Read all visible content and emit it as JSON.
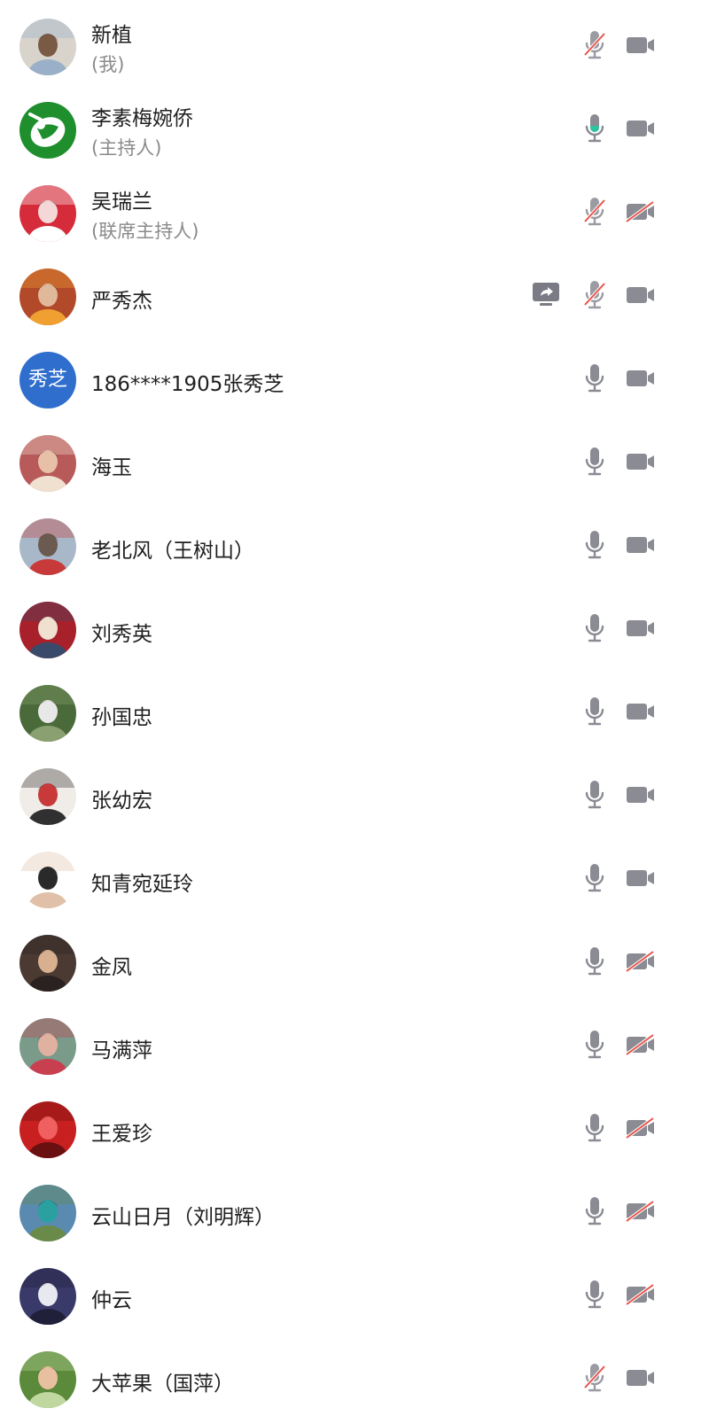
{
  "participants": [
    {
      "name": "新植",
      "role": "(我)",
      "mic": "muted",
      "cam": "on",
      "sharing": false,
      "avatar": {
        "type": "photo",
        "bg": "#d8d4cc",
        "fg": "#7a5a44",
        "accent": "#9ab0c8"
      }
    },
    {
      "name": "李素梅婉侨",
      "role": "(主持人)",
      "mic": "speaking",
      "cam": "on",
      "sharing": false,
      "avatar": {
        "type": "logo",
        "bg": "#1f8f2e",
        "fg": "#ffffff",
        "accent": "#1f8f2e"
      }
    },
    {
      "name": "吴瑞兰",
      "role": "(联席主持人)",
      "mic": "muted",
      "cam": "off",
      "sharing": false,
      "avatar": {
        "type": "photo",
        "bg": "#d52b3a",
        "fg": "#f4d8d8",
        "accent": "#ffffff"
      }
    },
    {
      "name": "严秀杰",
      "role": "",
      "mic": "muted",
      "cam": "on",
      "sharing": true,
      "avatar": {
        "type": "photo",
        "bg": "#b24a2a",
        "fg": "#e0b89a",
        "accent": "#f0a030"
      }
    },
    {
      "name": "186****1905张秀芝",
      "role": "",
      "mic": "on",
      "cam": "on",
      "sharing": false,
      "avatar": {
        "type": "text",
        "text": "秀芝",
        "bg": "#2f6ecd"
      }
    },
    {
      "name": "海玉",
      "role": "",
      "mic": "on",
      "cam": "on",
      "sharing": false,
      "avatar": {
        "type": "photo",
        "bg": "#b85a5a",
        "fg": "#e8c0a8",
        "accent": "#f0e0d0"
      }
    },
    {
      "name": "老北风（王树山）",
      "role": "",
      "mic": "on",
      "cam": "on",
      "sharing": false,
      "avatar": {
        "type": "photo",
        "bg": "#a8b8c8",
        "fg": "#6a5a50",
        "accent": "#c83a3a"
      }
    },
    {
      "name": "刘秀英",
      "role": "",
      "mic": "on",
      "cam": "on",
      "sharing": false,
      "avatar": {
        "type": "photo",
        "bg": "#a8202a",
        "fg": "#f0e0d0",
        "accent": "#3a4a6a"
      }
    },
    {
      "name": "孙国忠",
      "role": "",
      "mic": "on",
      "cam": "on",
      "sharing": false,
      "avatar": {
        "type": "photo",
        "bg": "#4a6a3a",
        "fg": "#e8e8e8",
        "accent": "#8aa070"
      }
    },
    {
      "name": "张幼宏",
      "role": "",
      "mic": "on",
      "cam": "on",
      "sharing": false,
      "avatar": {
        "type": "photo",
        "bg": "#f0ece8",
        "fg": "#c83a3a",
        "accent": "#303030"
      }
    },
    {
      "name": "知青宛延玲",
      "role": "",
      "mic": "on",
      "cam": "on",
      "sharing": false,
      "avatar": {
        "type": "photo",
        "bg": "#ffffff",
        "fg": "#2a2a2a",
        "accent": "#e0c0a8"
      }
    },
    {
      "name": "金凤",
      "role": "",
      "mic": "on",
      "cam": "off",
      "sharing": false,
      "avatar": {
        "type": "photo",
        "bg": "#4a3a32",
        "fg": "#d8b090",
        "accent": "#2a2220"
      }
    },
    {
      "name": "马满萍",
      "role": "",
      "mic": "on",
      "cam": "off",
      "sharing": false,
      "avatar": {
        "type": "photo",
        "bg": "#7a9a8a",
        "fg": "#e0b0a0",
        "accent": "#c84050"
      }
    },
    {
      "name": "王爱珍",
      "role": "",
      "mic": "on",
      "cam": "off",
      "sharing": false,
      "avatar": {
        "type": "photo",
        "bg": "#c82020",
        "fg": "#f06060",
        "accent": "#6a1010"
      }
    },
    {
      "name": "云山日月（刘明辉）",
      "role": "",
      "mic": "on",
      "cam": "off",
      "sharing": false,
      "avatar": {
        "type": "photo",
        "bg": "#5a8ab0",
        "fg": "#2aa0a0",
        "accent": "#6a8a4a"
      }
    },
    {
      "name": "仲云",
      "role": "",
      "mic": "on",
      "cam": "off",
      "sharing": false,
      "avatar": {
        "type": "photo",
        "bg": "#3a3a6a",
        "fg": "#e8e8f0",
        "accent": "#20203a"
      }
    },
    {
      "name": "大苹果（国萍）",
      "role": "",
      "mic": "muted",
      "cam": "on",
      "sharing": false,
      "avatar": {
        "type": "photo",
        "bg": "#5a8a3a",
        "fg": "#e8c0a0",
        "accent": "#c0d8a0"
      }
    }
  ],
  "colors": {
    "icon": "#8a8b93",
    "icon_muted": "#9a9ba3",
    "slash": "#e8534a",
    "speaking": "#2ec4a0",
    "name": "#1f1f1f",
    "role": "#8a8a8a",
    "share": "#7a7b84"
  }
}
